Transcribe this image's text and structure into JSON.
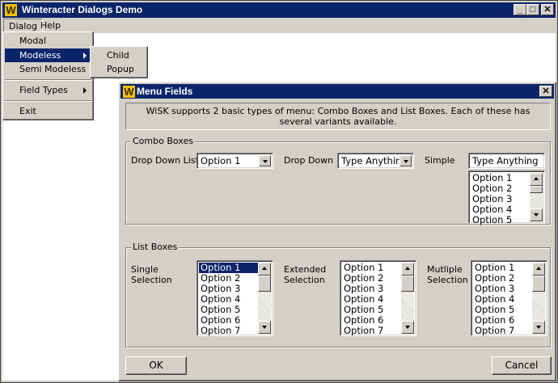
{
  "app": {
    "title": "Winteracter Dialogs Demo",
    "logo_letter": "W",
    "caption_buttons": {
      "minimize": "_",
      "maximize": "□",
      "close": "✕"
    }
  },
  "menubar": {
    "items": [
      "Dialog",
      "Help"
    ]
  },
  "dialog_menu": {
    "items": [
      "Modal",
      "Modeless",
      "Semi Modeless",
      "Field Types",
      "Exit"
    ]
  },
  "modeless_submenu": {
    "items": [
      "Child",
      "Popup"
    ]
  },
  "menu_fields_dialog": {
    "title": "Menu Fields",
    "logo_letter": "W",
    "close_glyph": "✕",
    "description": "WiSK supports 2 basic types of menu: Combo Boxes and List Boxes. Each of these has several variants available.",
    "combo_boxes": {
      "group_label": "Combo Boxes",
      "drop_down_list": {
        "label": "Drop Down List",
        "value": "Option  1"
      },
      "drop_down": {
        "label": "Drop Down",
        "value": "Type Anything"
      },
      "simple": {
        "label": "Simple",
        "value": "Type Anything",
        "list": [
          "Option  1",
          "Option  2",
          "Option  3",
          "Option  4",
          "Option  5"
        ]
      }
    },
    "list_boxes": {
      "group_label": "List Boxes",
      "single": {
        "label_line1": "Single",
        "label_line2": "Selection",
        "items": [
          "Option  1",
          "Option  2",
          "Option  3",
          "Option  4",
          "Option  5",
          "Option  6",
          "Option  7"
        ],
        "selected": "Option  1"
      },
      "extended": {
        "label_line1": "Extended",
        "label_line2": "Selection",
        "items": [
          "Option  1",
          "Option  2",
          "Option  3",
          "Option  4",
          "Option  5",
          "Option  6",
          "Option  7"
        ]
      },
      "multiple": {
        "label_line1": "Mutliple",
        "label_line2": "Selection",
        "items": [
          "Option  1",
          "Option  2",
          "Option  3",
          "Option  4",
          "Option  5",
          "Option  6",
          "Option  7"
        ]
      }
    },
    "buttons": {
      "ok": "OK",
      "cancel": "Cancel"
    }
  },
  "colors": {
    "titlebar": "#0a246a",
    "face": "#d4d0c8",
    "selection": "#0a246a",
    "logo": "#f2c200"
  }
}
